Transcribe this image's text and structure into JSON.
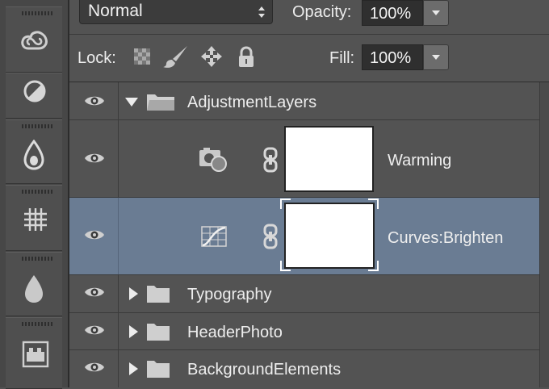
{
  "toolbar": {
    "blend_mode": "Normal",
    "opacity_label": "Opacity:",
    "opacity_value": "100%",
    "lock_label": "Lock:",
    "fill_label": "Fill:",
    "fill_value": "100%"
  },
  "tool_strip": {
    "items": [
      {
        "icon": "creative-cloud-icon"
      },
      {
        "icon": "adjustments-icon"
      },
      {
        "icon": "color-drop-icon"
      },
      {
        "icon": "grid-icon"
      },
      {
        "icon": "water-drop-icon"
      },
      {
        "icon": "layer-comps-icon"
      }
    ]
  },
  "layers": {
    "group_open": {
      "name": "AdjustmentLayers",
      "expanded": true
    },
    "children": [
      {
        "name": "Warming",
        "icon": "photo-filter-icon",
        "selected": false
      },
      {
        "name": "Curves:Brighten",
        "icon": "curves-icon",
        "selected": true
      }
    ],
    "groups": [
      {
        "name": "Typography",
        "expanded": false
      },
      {
        "name": "HeaderPhoto",
        "expanded": false
      },
      {
        "name": "BackgroundElements",
        "expanded": false
      }
    ]
  },
  "colors": {
    "panel": "#535353",
    "selected_row": "#6a7c93",
    "field": "#2f2f2f"
  }
}
